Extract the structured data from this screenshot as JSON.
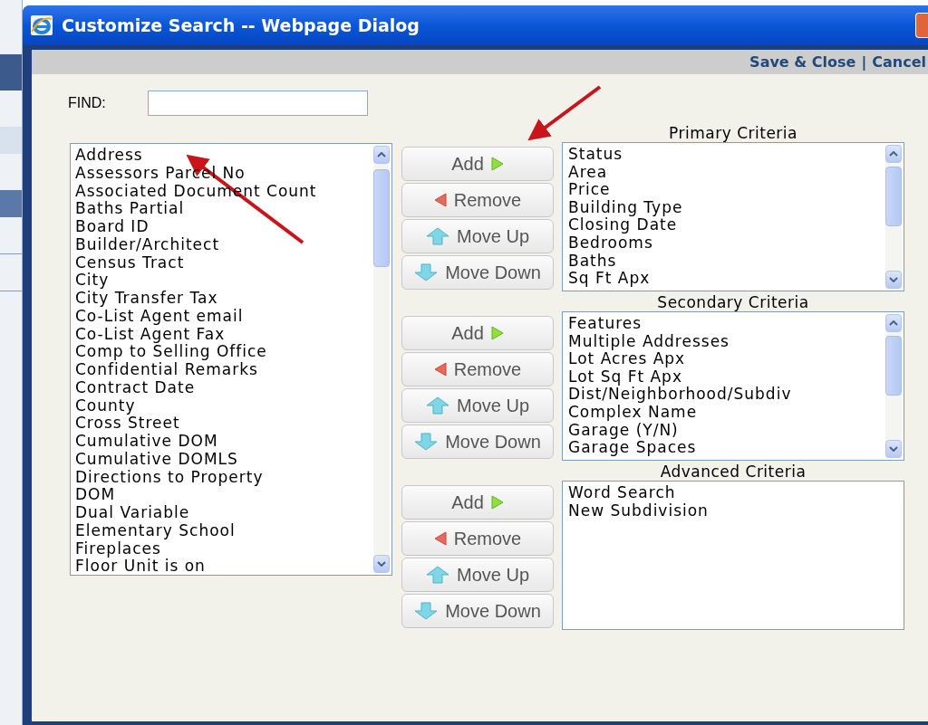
{
  "window": {
    "title": "Customize Search -- Webpage Dialog"
  },
  "toolbar": {
    "links": [
      {
        "label": "Save & Close"
      },
      {
        "label": "Cancel"
      }
    ],
    "separator": "|"
  },
  "find": {
    "label": "FIND:"
  },
  "available_fields": {
    "items": [
      "Address",
      "Assessors Parcel No",
      "Associated Document Count",
      "Baths Partial",
      "Board ID",
      "Builder/Architect",
      "Census Tract",
      "City",
      "City Transfer Tax",
      "Co-List Agent email",
      "Co-List Agent Fax",
      "Comp to Selling Office",
      "Confidential Remarks",
      "Contract Date",
      "County",
      "Cross Street",
      "Cumulative DOM",
      "Cumulative DOMLS",
      "Directions to Property",
      "DOM",
      "Dual Variable",
      "Elementary School",
      "Fireplaces",
      "Floor Unit is on"
    ]
  },
  "criteria": [
    {
      "title": "Primary Criteria",
      "scrollbar": true,
      "items": [
        "Status",
        "Area",
        "Price",
        "Building Type",
        "Closing Date",
        "Bedrooms",
        "Baths",
        "Sq Ft Apx"
      ],
      "buttons": [
        {
          "label": "Add",
          "kind": "add"
        },
        {
          "label": "Remove",
          "kind": "remove"
        },
        {
          "label": "Move Up",
          "kind": "up"
        },
        {
          "label": "Move Down",
          "kind": "down"
        }
      ]
    },
    {
      "title": "Secondary Criteria",
      "scrollbar": true,
      "items": [
        "Features",
        "Multiple Addresses",
        "Lot Acres Apx",
        "Lot Sq Ft Apx",
        "Dist/Neighborhood/Subdiv",
        "Complex Name",
        "Garage (Y/N)",
        "Garage Spaces"
      ],
      "buttons": [
        {
          "label": "Add",
          "kind": "add"
        },
        {
          "label": "Remove",
          "kind": "remove"
        },
        {
          "label": "Move Up",
          "kind": "up"
        },
        {
          "label": "Move Down",
          "kind": "down"
        }
      ]
    },
    {
      "title": "Advanced Criteria",
      "scrollbar": false,
      "items": [
        "Word Search",
        "New Subdivision"
      ],
      "buttons": [
        {
          "label": "Add",
          "kind": "add"
        },
        {
          "label": "Remove",
          "kind": "remove"
        },
        {
          "label": "Move Up",
          "kind": "up"
        },
        {
          "label": "Move Down",
          "kind": "down"
        }
      ]
    }
  ]
}
